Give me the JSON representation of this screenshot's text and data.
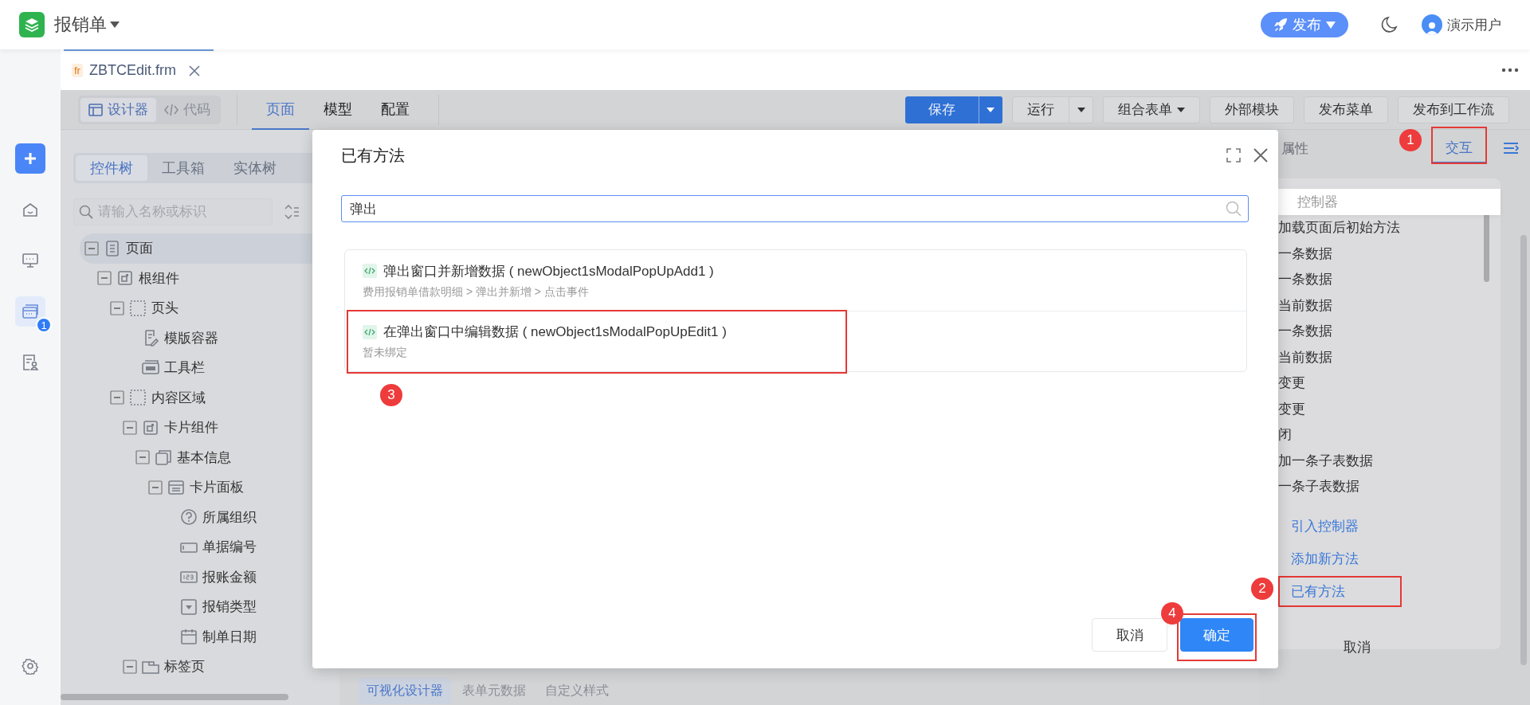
{
  "app": {
    "title": "报销单",
    "publish_button": "发布",
    "user": "演示用户"
  },
  "rail": [
    {
      "kind": "add",
      "selected": false
    },
    {
      "kind": "home",
      "selected": false
    },
    {
      "kind": "monitor",
      "selected": false
    },
    {
      "kind": "cards",
      "selected": true,
      "badge": "1"
    },
    {
      "kind": "form",
      "selected": false
    },
    {
      "kind": "settings",
      "selected": false
    }
  ],
  "file_tabs": [
    {
      "badge": "fr",
      "label": "ZBTCEdit.frm",
      "selected": true
    }
  ],
  "mode_switch": [
    {
      "label": "设计器",
      "kind": "designer",
      "selected": true
    },
    {
      "label": "代码",
      "kind": "code",
      "selected": false
    }
  ],
  "view_tabs": [
    {
      "label": "页面",
      "selected": true
    },
    {
      "label": "模型",
      "selected": false
    },
    {
      "label": "配置",
      "selected": false
    }
  ],
  "toolbar_buttons": [
    {
      "label": "保存",
      "kind": "primary-split"
    },
    {
      "label": "运行",
      "kind": "split"
    },
    {
      "label": "组合表单",
      "kind": "dropdown"
    },
    {
      "label": "外部模块",
      "kind": "plain"
    },
    {
      "label": "发布菜单",
      "kind": "plain"
    },
    {
      "label": "发布到工作流",
      "kind": "plain"
    }
  ],
  "left_panel": {
    "tabs": [
      {
        "label": "控件树",
        "selected": true
      },
      {
        "label": "工具箱",
        "selected": false
      },
      {
        "label": "实体树",
        "selected": false
      }
    ],
    "search_placeholder": "请输入名称或标识",
    "tree": [
      {
        "label": "页面",
        "kind": "page",
        "selected": true,
        "expanded": true,
        "children": [
          {
            "label": "根组件",
            "kind": "component",
            "selected": false,
            "expanded": true,
            "children": [
              {
                "label": "页头",
                "kind": "region",
                "selected": false,
                "expanded": true,
                "children": [
                  {
                    "label": "模版容器",
                    "kind": "template",
                    "selected": false
                  },
                  {
                    "label": "工具栏",
                    "kind": "toolbar",
                    "selected": false
                  }
                ]
              },
              {
                "label": "内容区域",
                "kind": "region",
                "selected": false,
                "expanded": true,
                "children": [
                  {
                    "label": "卡片组件",
                    "kind": "component",
                    "selected": false,
                    "expanded": true,
                    "children": [
                      {
                        "label": "基本信息",
                        "kind": "stack",
                        "selected": false,
                        "expanded": true,
                        "children": [
                          {
                            "label": "卡片面板",
                            "kind": "panel",
                            "selected": false,
                            "expanded": true,
                            "children": [
                              {
                                "label": "所属组织",
                                "kind": "help",
                                "selected": false
                              },
                              {
                                "label": "单据编号",
                                "kind": "input",
                                "selected": false
                              },
                              {
                                "label": "报账金额",
                                "kind": "number",
                                "selected": false
                              },
                              {
                                "label": "报销类型",
                                "kind": "select",
                                "selected": false
                              },
                              {
                                "label": "制单日期",
                                "kind": "date",
                                "selected": false
                              }
                            ]
                          }
                        ]
                      }
                    ]
                  },
                  {
                    "label": "标签页",
                    "kind": "tabs",
                    "selected": false,
                    "expanded": true
                  }
                ]
              }
            ]
          }
        ]
      }
    ]
  },
  "right_panel": {
    "tabs": [
      {
        "label": "属性",
        "selected": false
      },
      {
        "label": "交互",
        "selected": true,
        "marker": "1",
        "framed": true
      }
    ],
    "items": [
      {
        "text": "控制器",
        "kind": "header"
      },
      {
        "text": "加载页面后初始方法",
        "kind": "method"
      },
      {
        "text": "一条数据",
        "kind": "method"
      },
      {
        "text": "一条数据",
        "kind": "method"
      },
      {
        "text": "当前数据",
        "kind": "method"
      },
      {
        "text": "一条数据",
        "kind": "method"
      },
      {
        "text": "当前数据",
        "kind": "method"
      },
      {
        "text": "变更",
        "kind": "method"
      },
      {
        "text": "变更",
        "kind": "method"
      },
      {
        "text": "闭",
        "kind": "method"
      },
      {
        "text": "加一条子表数据",
        "kind": "method"
      },
      {
        "text": "一条子表数据",
        "kind": "method"
      }
    ],
    "links": [
      {
        "label": "引入控制器"
      },
      {
        "label": "添加新方法"
      },
      {
        "label": "已有方法",
        "marker": "2",
        "framed": true
      }
    ],
    "cancel": "取消"
  },
  "bottom_tabs": [
    {
      "label": "可视化设计器",
      "selected": true
    },
    {
      "label": "表单元数据",
      "selected": false
    },
    {
      "label": "自定义样式",
      "selected": false
    }
  ],
  "dialog": {
    "title": "已有方法",
    "search_value": "弹出",
    "methods": [
      {
        "title": "弹出窗口并新增数据 ( newObject1sModalPopUpAdd1 )",
        "binding": "费用报销单借款明细 > 弹出并新增 > 点击事件"
      },
      {
        "title": "在弹出窗口中编辑数据 ( newObject1sModalPopUpEdit1 )",
        "binding": "暂未绑定",
        "marker": "3",
        "framed": true
      }
    ],
    "buttons": [
      {
        "label": "取消",
        "kind": "default"
      },
      {
        "label": "确定",
        "kind": "primary",
        "marker": "4",
        "framed": true
      }
    ]
  }
}
